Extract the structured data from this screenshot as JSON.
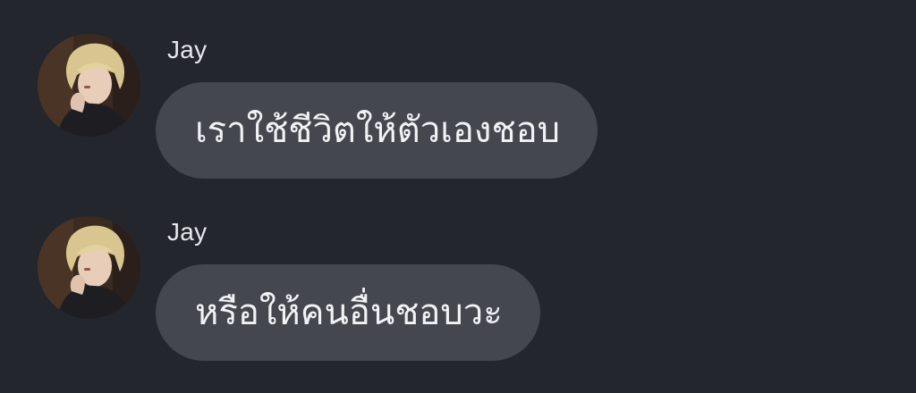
{
  "theme": {
    "background": "#24262e",
    "bubble": "#45474f",
    "text": "#f1f2f4",
    "sender_text": "#e6e7ea"
  },
  "messages": [
    {
      "sender": "Jay",
      "avatar": "profile-photo",
      "text": "เราใช้ชีวิตให้ตัวเองชอบ"
    },
    {
      "sender": "Jay",
      "avatar": "profile-photo",
      "text": "หรือให้คนอื่นชอบวะ"
    }
  ]
}
